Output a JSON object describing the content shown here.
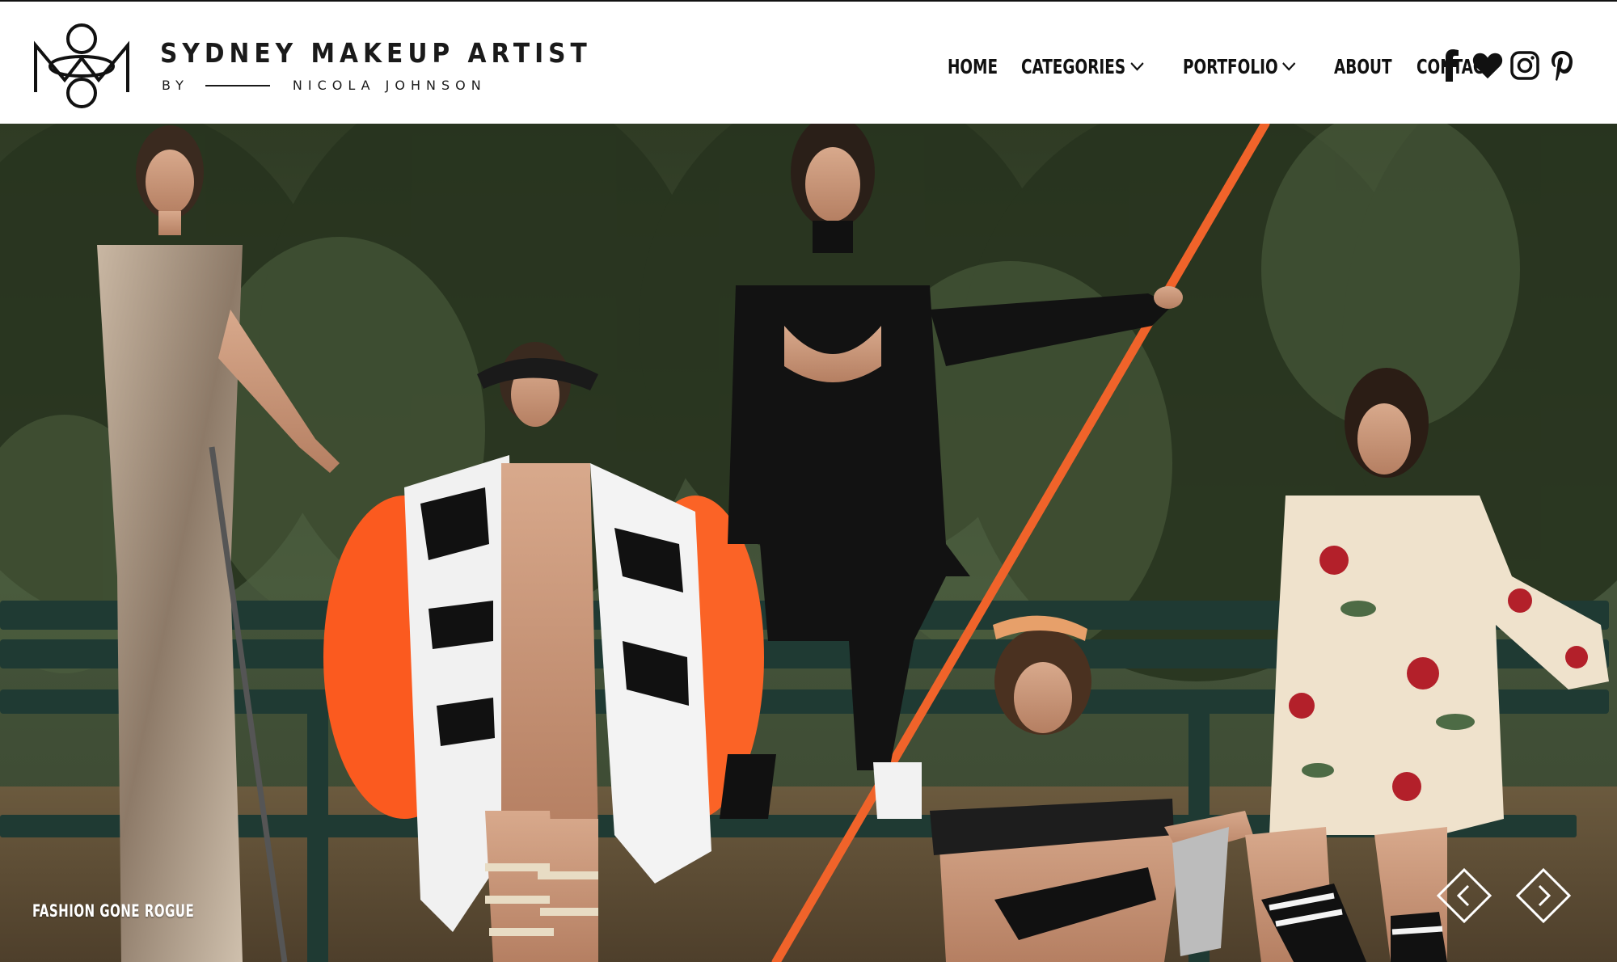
{
  "brand": {
    "title": "SYDNEY MAKEUP ARTIST",
    "by": "BY",
    "name": "NICOLA JOHNSON"
  },
  "nav": {
    "items": [
      {
        "label": "HOME",
        "has_dropdown": false
      },
      {
        "label": "CATEGORIES",
        "has_dropdown": true
      },
      {
        "label": "PORTFOLIO",
        "has_dropdown": true
      },
      {
        "label": "ABOUT",
        "has_dropdown": false
      },
      {
        "label": "CONTACT",
        "has_dropdown": false
      }
    ]
  },
  "social": [
    "facebook-icon",
    "heart-icon",
    "instagram-icon",
    "pinterest-icon"
  ],
  "hero": {
    "caption": "FASHION GONE ROGUE",
    "prev_icon": "chevron-left-diamond-icon",
    "next_icon": "chevron-right-diamond-icon"
  },
  "colors": {
    "text": "#111111",
    "foliage": "#3b4a2a",
    "bench": "#1f3a33",
    "ground": "#5a4a35",
    "orange": "#f45a24"
  }
}
